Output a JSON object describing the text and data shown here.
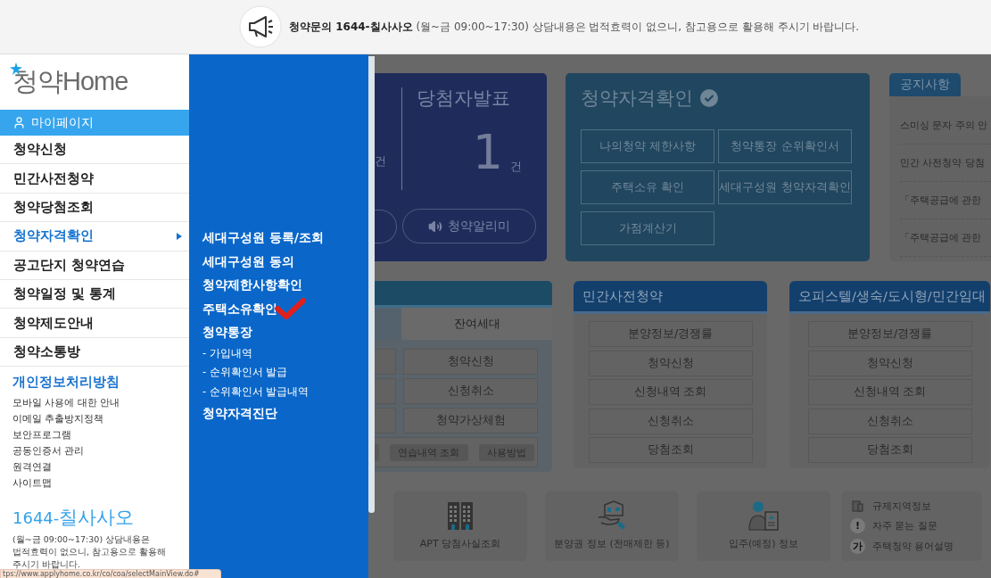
{
  "top_bar": {
    "text": "**청약문의 1644-칠사사오** (월~금 09:00~17:30) 상담내용은 법적효력이 없으니, 참고용으로 활용해 주시기 바랍니다."
  },
  "sidebar": {
    "logo": "청약Home",
    "mypage": "마이페이지",
    "items": [
      {
        "label": "청약신청",
        "selected": false
      },
      {
        "label": "민간사전청약",
        "selected": false
      },
      {
        "label": "청약당첨조회",
        "selected": false
      },
      {
        "label": "청약자격확인",
        "selected": true
      },
      {
        "label": "공고단지 청약연습",
        "selected": false
      },
      {
        "label": "청약일정 및 통계",
        "selected": false
      },
      {
        "label": "청약제도안내",
        "selected": false
      },
      {
        "label": "청약소통방",
        "selected": false
      }
    ],
    "policy_title": "개인정보처리방침",
    "links": [
      "모바일 사용에 대한 안내",
      "이메일 추출방지정책",
      "보안프로그램",
      "공동인증서 관리",
      "원격연결",
      "사이트맵"
    ],
    "phone_prefix": "1644-",
    "phone_name": "칠사사오",
    "note": [
      "(월~금 09:00~17:30) 상담내용은",
      "법적효력이 없으니, 참고용으로 활용해",
      "주시기 바랍니다."
    ]
  },
  "submenu": {
    "items": [
      {
        "kind": "item",
        "label": "세대구성원 등록/조회",
        "marked": false
      },
      {
        "kind": "item",
        "label": "세대구성원 동의",
        "marked": false
      },
      {
        "kind": "item",
        "label": "청약제한사항확인",
        "marked": false
      },
      {
        "kind": "item",
        "label": "주택소유확인",
        "marked": true
      },
      {
        "kind": "item",
        "label": "청약통장",
        "marked": false
      },
      {
        "kind": "sub",
        "label": "- 가입내역",
        "marked": false
      },
      {
        "kind": "sub",
        "label": "- 순위확인서 발급",
        "marked": false
      },
      {
        "kind": "sub",
        "label": "- 순위확인서 발급내역",
        "marked": false
      },
      {
        "kind": "item",
        "label": "청약자격진단",
        "marked": false
      }
    ]
  },
  "winners_card": {
    "left_unit": "건",
    "title": "당첨자발표",
    "count": "1",
    "unit": "건",
    "alert_button": "청약알리미"
  },
  "eligibility_card": {
    "title": "청약자격확인",
    "buttons": [
      "나의청약 제한사항",
      "청약통장 순위확인서",
      "주택소유 확인",
      "세대구성원 청약자격확인",
      "가점계산기"
    ]
  },
  "notice": {
    "tab": "공지사항",
    "items": [
      "스미싱 문자 주의 안",
      "민간 사전청약 당첨",
      "「주택공급에 관한",
      "「주택공급에 관한"
    ]
  },
  "apply_card": {
    "tab": "잔여세대",
    "buttons": [
      "청약신청",
      "신청취소",
      "청약가상체험"
    ],
    "chips": [
      "연습내역 조회",
      "사용방법"
    ]
  },
  "private_card": {
    "title": "민간사전청약",
    "buttons": [
      "분양정보/경쟁률",
      "청약신청",
      "신청내역 조회",
      "신청취소",
      "당첨조회"
    ]
  },
  "officetel_card": {
    "title": "오피스텔/생숙/도시형/민간임대",
    "buttons": [
      "분양정보/경쟁률",
      "청약신청",
      "신청내역 조회",
      "신청취소",
      "당첨조회"
    ]
  },
  "tiles": [
    {
      "kind": "apt",
      "label": "APT 당첨사실조회"
    },
    {
      "kind": "hand",
      "label": "분양권 정보 (전매제한 등)"
    },
    {
      "kind": "person",
      "label": "입주(예정) 정보"
    }
  ],
  "quick_links": [
    {
      "kind": "doc",
      "label": "규제지역정보"
    },
    {
      "kind": "glyph",
      "glyph": "!",
      "label": "자주 묻는 질문"
    },
    {
      "kind": "glyph",
      "glyph": "가",
      "label": "주택청약 용어설명"
    }
  ],
  "status_url": "tps://www.applyhome.co.kr/co/coa/selectMainView.do#"
}
